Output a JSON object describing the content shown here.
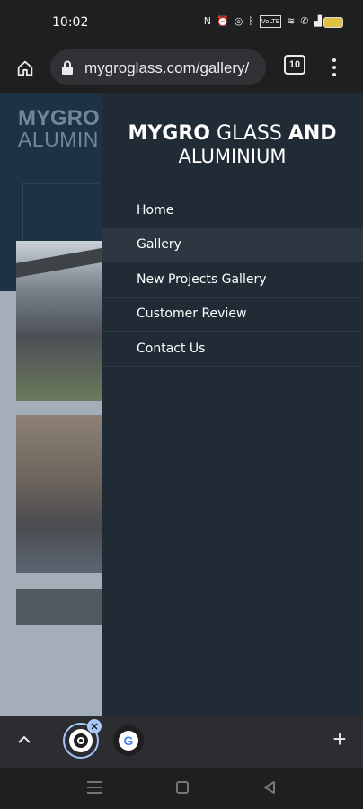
{
  "status_bar": {
    "time": "10:02",
    "icons": [
      "nfc-icon",
      "alarm-icon",
      "hotspot-icon",
      "bluetooth-icon",
      "volte-icon",
      "wifi-icon",
      "call-icon",
      "signal-icon",
      "battery-icon"
    ],
    "volte_label": "VoLTE"
  },
  "browser": {
    "url": "mygroglass.com/gallery/",
    "tab_count": "10"
  },
  "page_background": {
    "logo_line1": "MYGRO",
    "logo_line2": "ALUMIN"
  },
  "drawer": {
    "brand_bold_1": "MYGRO",
    "brand_thin": "GLASS",
    "brand_bold_2": "AND",
    "brand_line2": "ALUMINIUM",
    "nav_items": [
      {
        "label": "Home"
      },
      {
        "label": "Gallery",
        "active": true
      },
      {
        "label": "New Projects Gallery"
      },
      {
        "label": "Customer Review"
      },
      {
        "label": "Contact Us"
      }
    ]
  },
  "tab_strip": {
    "google_letter": "G",
    "new_tab_label": "+"
  },
  "colors": {
    "drawer_bg": "#212b36",
    "active_item_bg": "#2c3742",
    "header_bg": "#1d3344",
    "tab_accent": "#a8c7fa"
  }
}
